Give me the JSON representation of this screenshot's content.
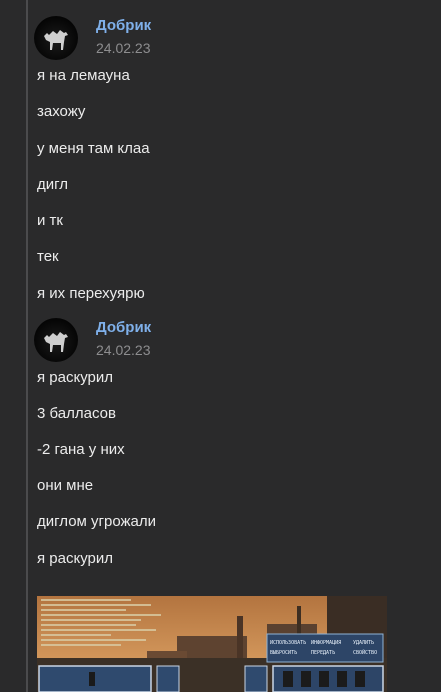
{
  "posts": [
    {
      "author": "Добрик",
      "date": "24.02.23",
      "lines": [
        "я на лемауна",
        "захожу",
        "у меня там клаа",
        "дигл",
        "и тк",
        "тек",
        "я их перехуярю"
      ]
    },
    {
      "author": "Добрик",
      "date": "24.02.23",
      "lines": [
        "я раскурил",
        "3 балласов",
        "-2 гана у них",
        "они мне",
        "диглом угрожали",
        "я раскурил"
      ]
    }
  ],
  "attachment": {
    "menu_row1": [
      "ИСПОЛЬЗОВАТЬ",
      "ИНФОРМАЦИЯ",
      "УДАЛИТЬ"
    ],
    "menu_row2": [
      "ВЫБРОСИТЬ",
      "ПЕРЕДАТЬ",
      "СВОЙСТВО"
    ]
  },
  "colors": {
    "background": "#2a2a2b",
    "author": "#7fb0ea",
    "date": "#8d8d8f",
    "text": "#ececec"
  }
}
